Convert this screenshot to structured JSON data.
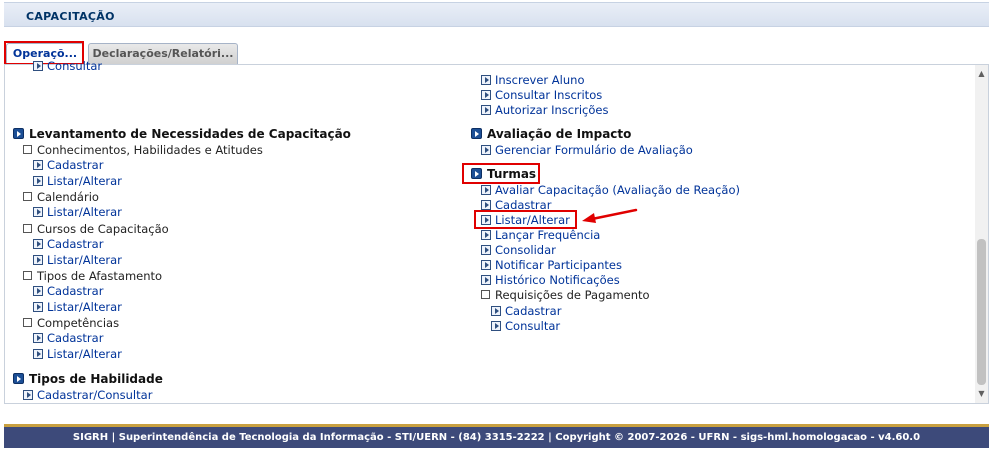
{
  "header": {
    "title": "CAPACITAÇÃO"
  },
  "tabs": [
    {
      "label": "Operaçõ..."
    },
    {
      "label": "Declarações/Relatóri..."
    }
  ],
  "left_column": {
    "top_cut": "Consultar",
    "levantamento": {
      "title": "Levantamento de Necessidades de Capacitação",
      "cha": {
        "label": "Conhecimentos, Habilidades e Atitudes",
        "cadastrar": "Cadastrar",
        "listar": "Listar/Alterar"
      },
      "calendario": {
        "label": "Calendário",
        "listar": "Listar/Alterar"
      },
      "cursos": {
        "label": "Cursos de Capacitação",
        "cadastrar": "Cadastrar",
        "listar": "Listar/Alterar"
      },
      "afastamento": {
        "label": "Tipos de Afastamento",
        "cadastrar": "Cadastrar",
        "listar": "Listar/Alterar"
      },
      "competencias": {
        "label": "Competências",
        "cadastrar": "Cadastrar",
        "listar": "Listar/Alterar"
      }
    },
    "tipos_habilidade": {
      "title": "Tipos de Habilidade",
      "cadastrar_consultar": "Cadastrar/Consultar"
    }
  },
  "right_column": {
    "inscricoes": {
      "inscrever": "Inscrever Aluno",
      "consultar": "Consultar Inscritos",
      "autorizar": "Autorizar Inscrições"
    },
    "avaliacao": {
      "title": "Avaliação de Impacto",
      "gerenciar": "Gerenciar Formulário de Avaliação"
    },
    "turmas": {
      "title": "Turmas",
      "avaliar": "Avaliar Capacitação (Avaliação de Reação)",
      "cadastrar": "Cadastrar",
      "listar": "Listar/Alterar",
      "frequencia": "Lançar Frequência",
      "consolidar": "Consolidar",
      "notificar": "Notificar Participantes",
      "historico": "Histórico Notificações",
      "requisicoes": {
        "label": "Requisições de Pagamento",
        "cadastrar": "Cadastrar",
        "consultar": "Consultar"
      }
    }
  },
  "footer": {
    "text": "SIGRH | Superintendência de Tecnologia da Informação - STI/UERN - (84) 3315-2222 | Copyright © 2007-2026 - UFRN - sigs-hml.homologacao - v4.60.0"
  },
  "colors": {
    "link": "#003399",
    "highlight": "#e00000",
    "footer_bg": "#3d4a7a"
  }
}
